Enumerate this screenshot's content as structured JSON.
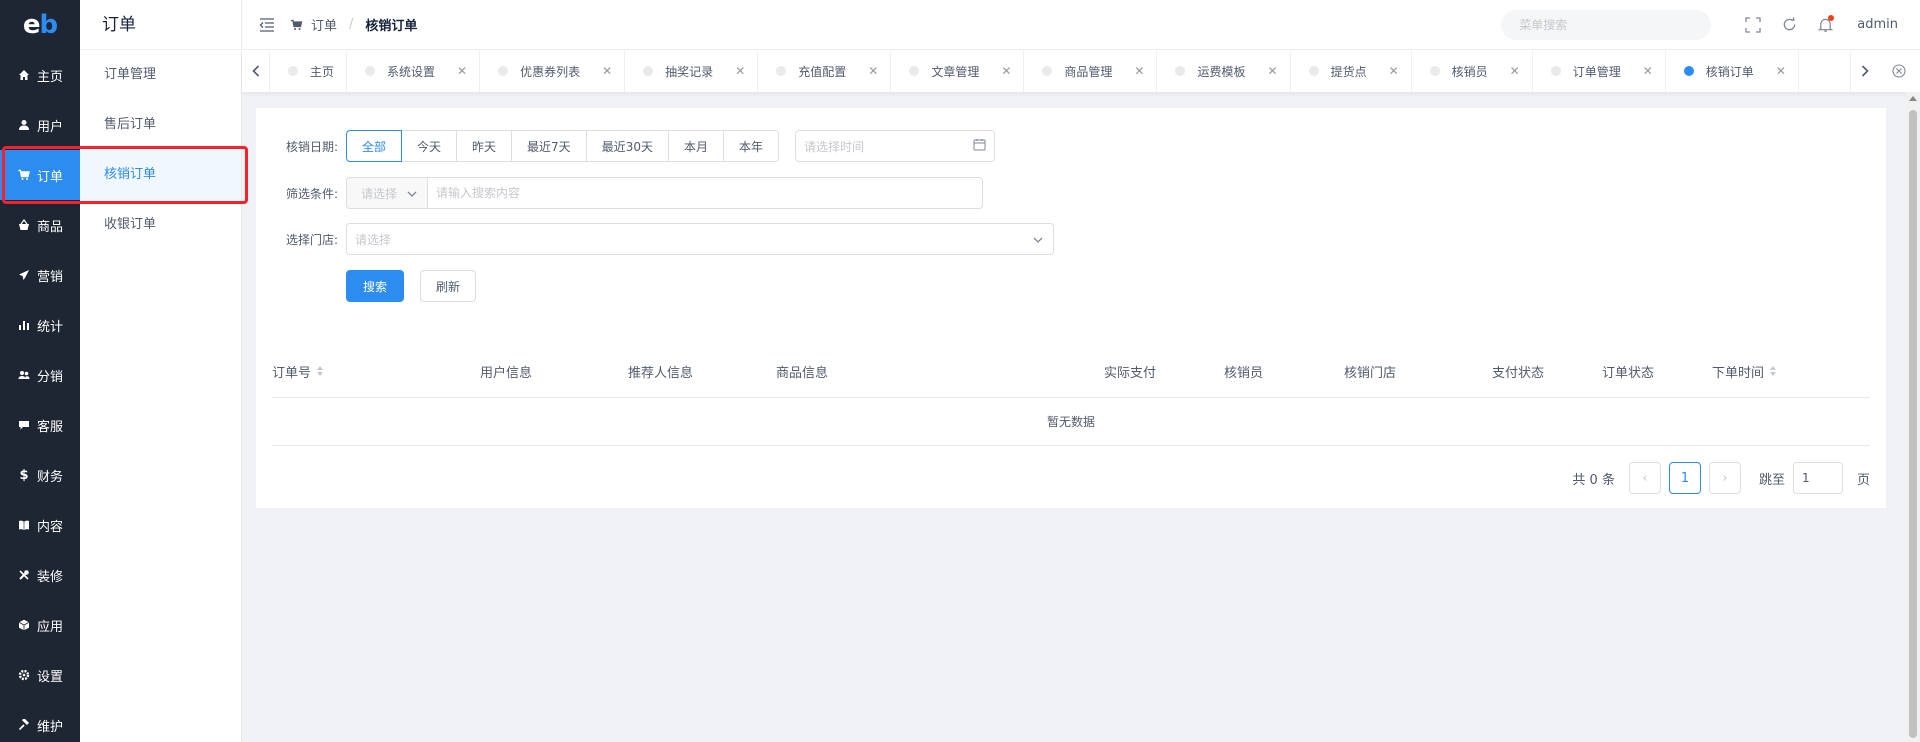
{
  "logo": {
    "e": "e",
    "b": "b"
  },
  "dark_menu": [
    {
      "label": "主页",
      "icon": "home-icon"
    },
    {
      "label": "用户",
      "icon": "user-icon"
    },
    {
      "label": "订单",
      "icon": "cart-icon",
      "active": true
    },
    {
      "label": "商品",
      "icon": "basket-icon"
    },
    {
      "label": "营销",
      "icon": "paper-plane-icon"
    },
    {
      "label": "统计",
      "icon": "bar-chart-icon"
    },
    {
      "label": "分销",
      "icon": "users-icon"
    },
    {
      "label": "客服",
      "icon": "chat-icon"
    },
    {
      "label": "财务",
      "icon": "dollar-icon"
    },
    {
      "label": "内容",
      "icon": "book-icon"
    },
    {
      "label": "装修",
      "icon": "tools-icon"
    },
    {
      "label": "应用",
      "icon": "cube-icon"
    },
    {
      "label": "设置",
      "icon": "gear-icon"
    },
    {
      "label": "维护",
      "icon": "hammer-icon"
    }
  ],
  "sub_menu": {
    "title": "订单",
    "items": [
      {
        "label": "订单管理"
      },
      {
        "label": "售后订单"
      },
      {
        "label": "核销订单",
        "active": true
      },
      {
        "label": "收银订单"
      }
    ]
  },
  "header": {
    "breadcrumb_1": "订单",
    "breadcrumb_sep": "/",
    "breadcrumb_2": "核销订单",
    "search_placeholder": "菜单搜索",
    "username": "admin"
  },
  "tabs": [
    {
      "label": "主页",
      "closable": false
    },
    {
      "label": "系统设置",
      "closable": true
    },
    {
      "label": "优惠券列表",
      "closable": true
    },
    {
      "label": "抽奖记录",
      "closable": true
    },
    {
      "label": "充值配置",
      "closable": true
    },
    {
      "label": "文章管理",
      "closable": true
    },
    {
      "label": "商品管理",
      "closable": true
    },
    {
      "label": "运费模板",
      "closable": true
    },
    {
      "label": "提货点",
      "closable": true
    },
    {
      "label": "核销员",
      "closable": true
    },
    {
      "label": "订单管理",
      "closable": true
    },
    {
      "label": "核销订单",
      "closable": true,
      "active": true
    }
  ],
  "filters": {
    "date_label": "核销日期:",
    "date_options": [
      "全部",
      "今天",
      "昨天",
      "最近7天",
      "最近30天",
      "本月",
      "本年"
    ],
    "date_selected": "全部",
    "date_placeholder": "请选择时间",
    "cond_label": "筛选条件:",
    "cond_select_placeholder": "请选择",
    "cond_input_placeholder": "请输入搜索内容",
    "store_label": "选择门店:",
    "store_placeholder": "请选择",
    "search_btn": "搜索",
    "refresh_btn": "刷新"
  },
  "table": {
    "columns": [
      "订单号",
      "用户信息",
      "推荐人信息",
      "商品信息",
      "实际支付",
      "核销员",
      "核销门店",
      "支付状态",
      "订单状态",
      "下单时间"
    ],
    "empty_text": "暂无数据"
  },
  "pagination": {
    "total_text": "共 0 条",
    "prev": "‹",
    "current_page": "1",
    "next": "›",
    "jump_label": "跳至",
    "jump_value": "1",
    "page_suffix": "页"
  },
  "colors": {
    "primary": "#2d8cf0",
    "sidebar": "#1f2633",
    "highlight": "#f5222d"
  }
}
